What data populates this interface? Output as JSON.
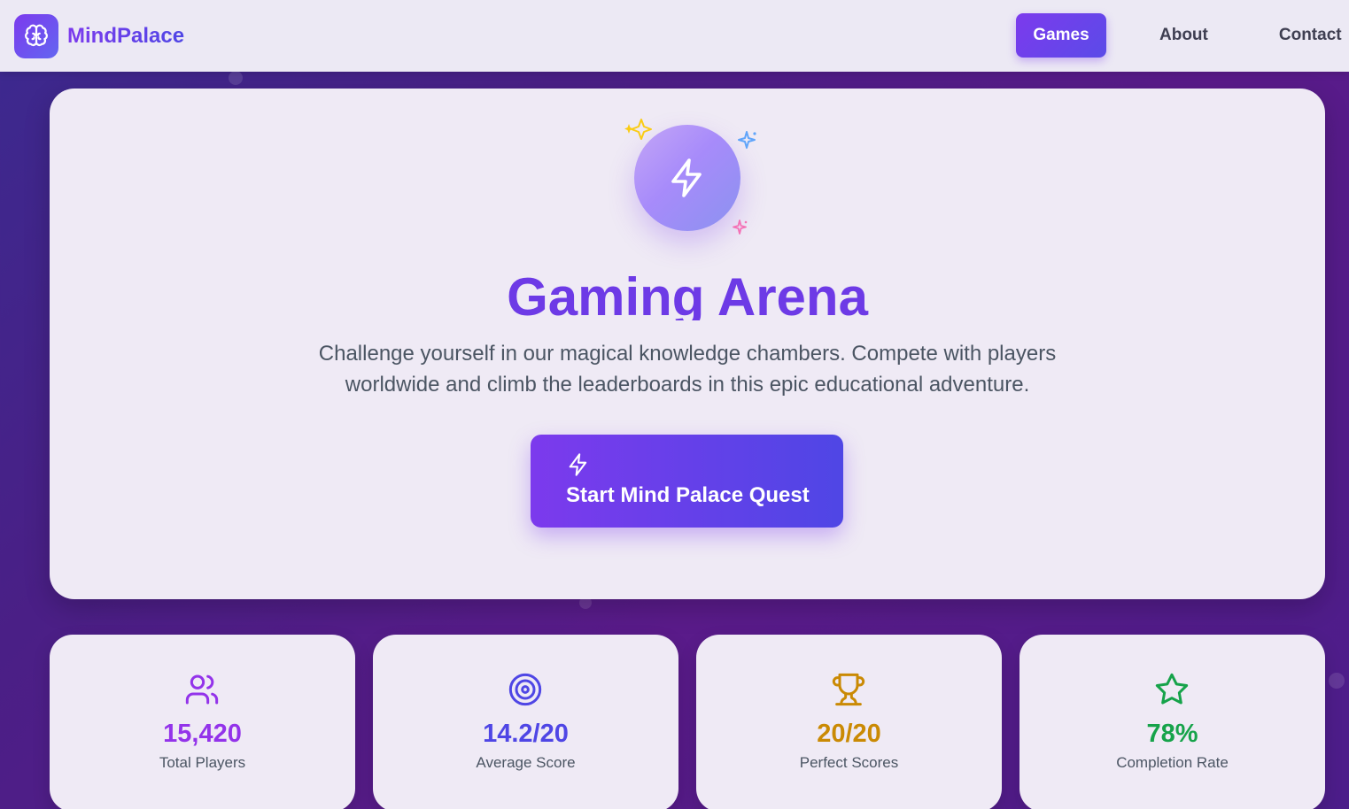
{
  "brand": {
    "name": "MindPalace",
    "logo_icon": "brain-icon"
  },
  "nav": {
    "items": [
      {
        "label": "Games",
        "active": true
      },
      {
        "label": "About",
        "active": false
      },
      {
        "label": "Contact",
        "active": false
      }
    ]
  },
  "hero": {
    "icon": "lightning-icon",
    "title": "Gaming Arena",
    "description": "Challenge yourself in our magical knowledge chambers. Compete with players worldwide and climb the leaderboards in this epic educational adventure.",
    "cta_label": "Start Mind Palace Quest",
    "cta_icon": "lightning-icon"
  },
  "stats": [
    {
      "icon": "users-icon",
      "value": "15,420",
      "label": "Total Players",
      "color": "#9333ea"
    },
    {
      "icon": "target-icon",
      "value": "14.2/20",
      "label": "Average Score",
      "color": "#4f46e5"
    },
    {
      "icon": "trophy-icon",
      "value": "20/20",
      "label": "Perfect Scores",
      "color": "#ca8a04"
    },
    {
      "icon": "star-icon",
      "value": "78%",
      "label": "Completion Rate",
      "color": "#16a34a"
    }
  ],
  "colors": {
    "primary": "#7c3aed",
    "accent": "#4f46e5",
    "background": "#4a1f86",
    "card": "#efeaf5"
  }
}
